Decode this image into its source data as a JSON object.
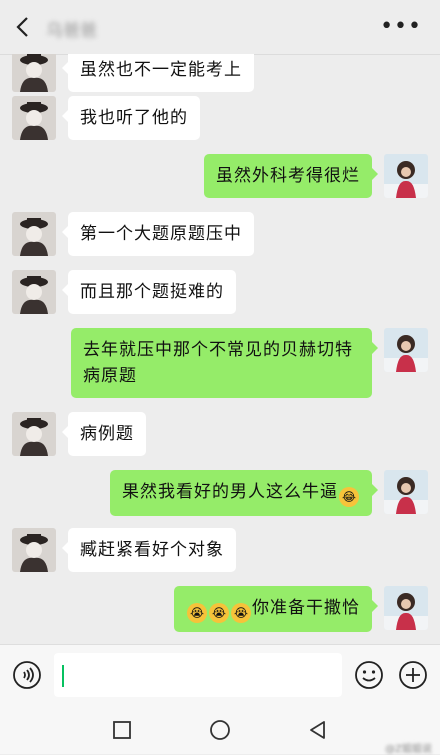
{
  "header": {
    "title": "乌爸爸",
    "more_label": "•••"
  },
  "messages": [
    {
      "side": "left",
      "text": "虽然也不一定能考上"
    },
    {
      "side": "left",
      "text": "我也听了他的"
    },
    {
      "side": "right",
      "text": "虽然外科考得很烂"
    },
    {
      "side": "left",
      "text": "第一个大题原题压中"
    },
    {
      "side": "left",
      "text": "而且那个题挺难的"
    },
    {
      "side": "right",
      "text": "去年就压中那个不常见的贝赫切特病原题"
    },
    {
      "side": "left",
      "text": "病例题"
    },
    {
      "side": "right",
      "text": "果然我看好的男人这么牛逼",
      "emoji_after": "laughing-tears"
    },
    {
      "side": "left",
      "text": "赶紧看好个对象",
      "prefix": "臧"
    },
    {
      "side": "right",
      "text": "你准备干撒恰",
      "emoji_before": [
        "crying",
        "crying",
        "crying"
      ]
    }
  ],
  "input": {
    "value": ""
  },
  "watermark": {
    "text": "@Z姐姐说"
  },
  "colors": {
    "background": "#ededed",
    "outgoing_bubble": "#95ec69",
    "incoming_bubble": "#ffffff",
    "caret": "#07c160"
  }
}
